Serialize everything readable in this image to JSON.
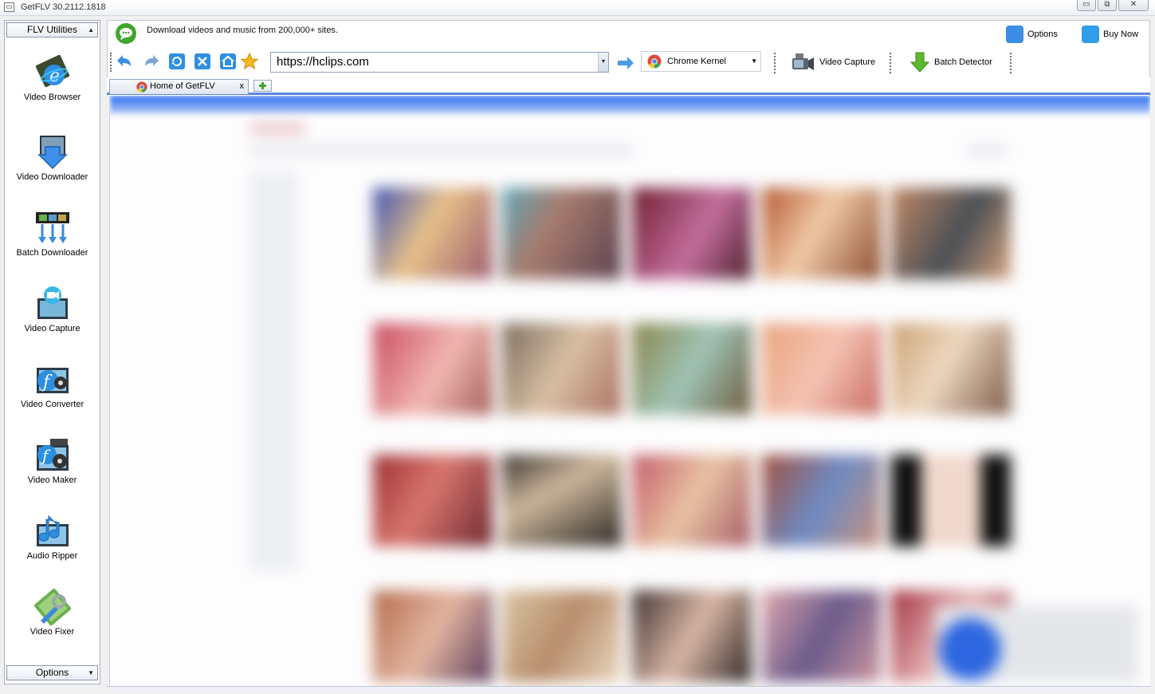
{
  "window": {
    "title": "GetFLV 30.2112.1818",
    "controls": {
      "minimize": "▭",
      "restore": "⧉",
      "close": "✕"
    }
  },
  "sidebar": {
    "header_combo": "FLV Utilities",
    "footer_combo": "Options",
    "tools": [
      {
        "label": "Video Browser",
        "icon": "video-browser-icon",
        "selected": true
      },
      {
        "label": "Video Downloader",
        "icon": "video-downloader-icon"
      },
      {
        "label": "Batch Downloader",
        "icon": "batch-downloader-icon"
      },
      {
        "label": "Video Capture",
        "icon": "video-capture-icon"
      },
      {
        "label": "Video Converter",
        "icon": "video-converter-icon"
      },
      {
        "label": "Video Maker",
        "icon": "video-maker-icon"
      },
      {
        "label": "Audio Ripper",
        "icon": "audio-ripper-icon"
      },
      {
        "label": "Video Fixer",
        "icon": "video-fixer-icon"
      }
    ]
  },
  "header": {
    "message": "Download videos and music from 200,000+ sites.",
    "options_label": "Options",
    "buy_label": "Buy Now"
  },
  "toolbar": {
    "url": "https://hclips.com",
    "kernel": "Chrome Kernel",
    "video_capture_label": "Video Capture",
    "batch_detector_label": "Batch Detector"
  },
  "tabs": [
    {
      "title": "Home of GetFLV",
      "close": "x"
    }
  ],
  "colors": {
    "accent": "#5c86d8",
    "panel_border": "#a9b4c2"
  }
}
